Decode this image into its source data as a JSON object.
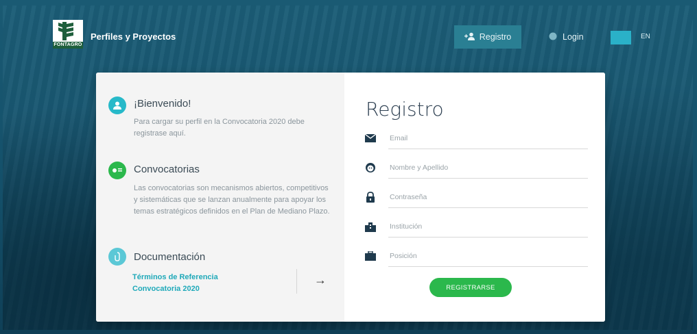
{
  "header": {
    "brand": "Perfiles y Proyectos",
    "logo_text": "FONTAGRO",
    "nav": {
      "registro": "Registro",
      "login": "Login",
      "lang": "EN"
    }
  },
  "left": {
    "welcome": {
      "title": "¡Bienvenido!",
      "body": "Para cargar su perfil en la Convocatoria 2020 debe registrase aquí."
    },
    "convocatorias": {
      "title": "Convocatorias",
      "body": "Las convocatorias son mecanismos abiertos, competitivos y sistemáticas que se lanzan anualmente para apoyar los temas estratégicos definidos en el Plan de Mediano Plazo."
    },
    "documentacion": {
      "title": "Documentación",
      "link_line1": "Términos de Referencia",
      "link_line2": "Convocatoria 2020",
      "arrow": "→"
    }
  },
  "form": {
    "title": "Registro",
    "fields": [
      {
        "placeholder": "Email",
        "icon": "envelope-icon"
      },
      {
        "placeholder": "Nombre y Apellido",
        "icon": "face-icon"
      },
      {
        "placeholder": "Contraseña",
        "icon": "lock-icon"
      },
      {
        "placeholder": "Institución",
        "icon": "building-icon"
      },
      {
        "placeholder": "Posición",
        "icon": "briefcase-icon"
      }
    ],
    "submit": "REGISTRARSE"
  },
  "colors": {
    "accent": "#27b9c9",
    "button": "#2bb84c",
    "header_active": "#2a7f93"
  }
}
